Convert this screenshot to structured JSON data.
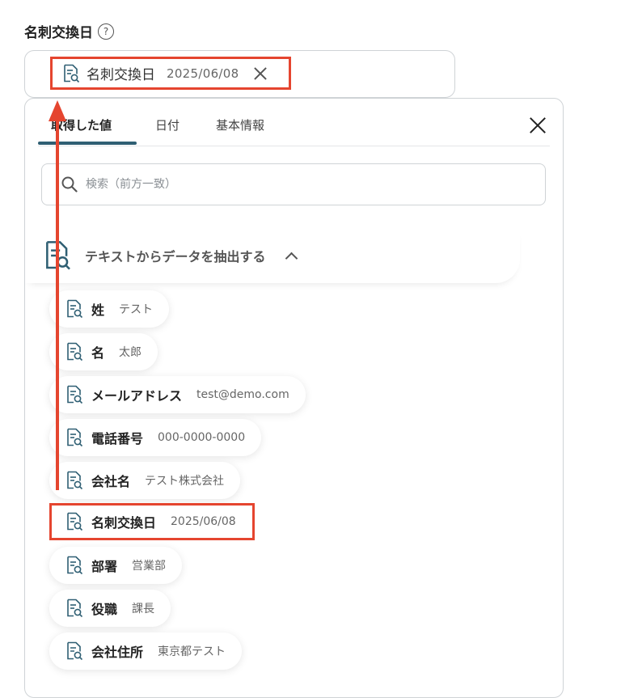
{
  "field": {
    "label": "名刺交換日",
    "help_icon": "question-circle-icon"
  },
  "input": {
    "chip_name": "名刺交換日",
    "chip_value": "2025/06/08"
  },
  "panel": {
    "tabs": [
      {
        "label": "取得した値",
        "active": true
      },
      {
        "label": "日付"
      },
      {
        "label": "基本情報"
      }
    ],
    "search_placeholder": "検索（前方一致）",
    "group_title": "テキストからデータを抽出する",
    "items": [
      {
        "name": "姓",
        "value": "テスト"
      },
      {
        "name": "名",
        "value": "太郎"
      },
      {
        "name": "メールアドレス",
        "value": "test@demo.com"
      },
      {
        "name": "電話番号",
        "value": "000-0000-0000"
      },
      {
        "name": "会社名",
        "value": "テスト株式会社"
      },
      {
        "name": "名刺交換日",
        "value": "2025/06/08",
        "highlighted": true
      },
      {
        "name": "部署",
        "value": "営業部"
      },
      {
        "name": "役職",
        "value": "課長"
      },
      {
        "name": "会社住所",
        "value": "東京都テスト"
      }
    ]
  },
  "colors": {
    "highlight": "#e5452f",
    "tab_accent": "#2f5f73",
    "icon": "#2f5f73"
  }
}
